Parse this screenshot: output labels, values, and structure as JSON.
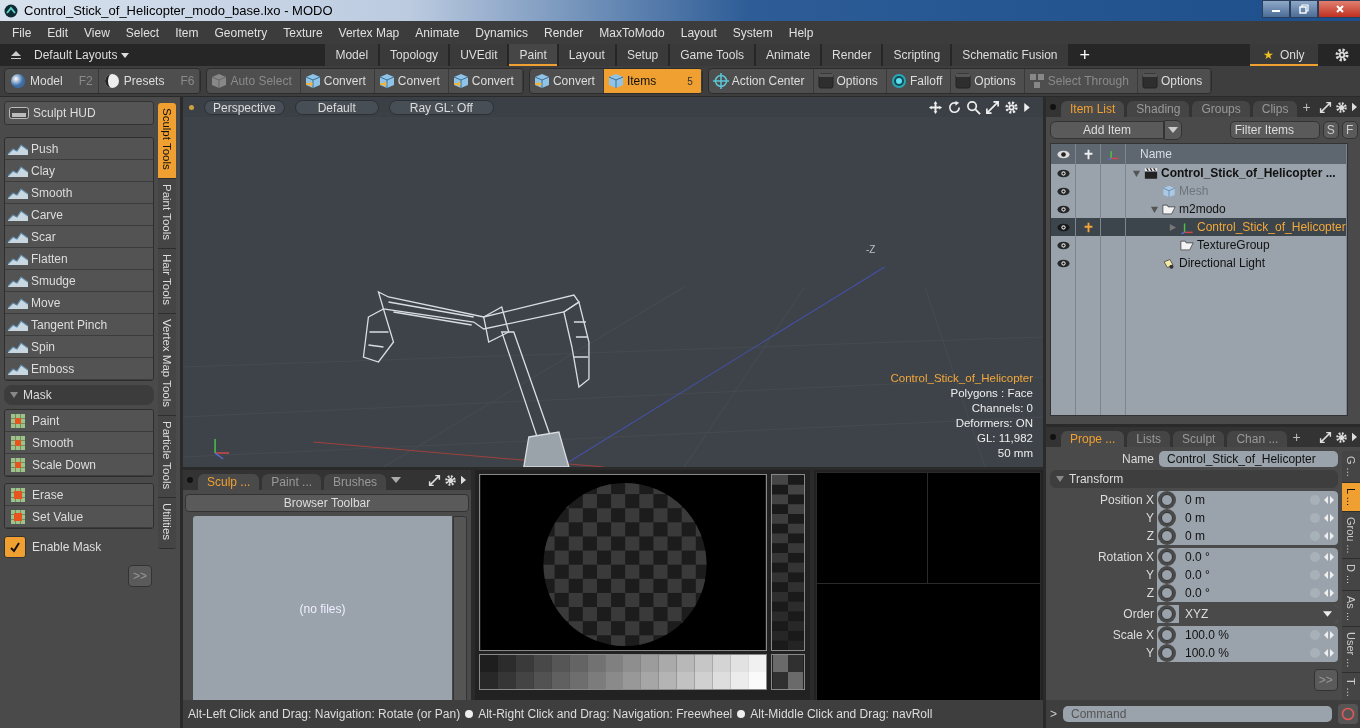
{
  "window": {
    "title": "Control_Stick_of_Helicopter_modo_base.lxo - MODO"
  },
  "menu": [
    "File",
    "Edit",
    "View",
    "Select",
    "Item",
    "Geometry",
    "Texture",
    "Vertex Map",
    "Animate",
    "Dynamics",
    "Render",
    "MaxToModo",
    "Layout",
    "System",
    "Help"
  ],
  "layout_bar": {
    "layouts_label": "Default Layouts",
    "tabs": [
      {
        "label": "Model",
        "selected": false
      },
      {
        "label": "Topology",
        "selected": false
      },
      {
        "label": "UVEdit",
        "selected": false
      },
      {
        "label": "Paint",
        "selected": true
      },
      {
        "label": "Layout",
        "selected": false
      },
      {
        "label": "Setup",
        "selected": false
      },
      {
        "label": "Game Tools",
        "selected": false
      },
      {
        "label": "Animate",
        "selected": false
      },
      {
        "label": "Render",
        "selected": false
      },
      {
        "label": "Scripting",
        "selected": false
      },
      {
        "label": "Schematic Fusion",
        "selected": false
      }
    ],
    "add_label": "+",
    "only": {
      "star": "★",
      "label": "Only",
      "on": true
    }
  },
  "toolbar": {
    "modes": [
      {
        "label": "Model",
        "key": "F2",
        "kind": "sphere"
      },
      {
        "label": "Presets",
        "key": "F6",
        "kind": "shade"
      }
    ],
    "groups": [
      [
        {
          "label": "Auto Select",
          "kind": "select",
          "disabled": true,
          "selected": false
        },
        {
          "label": "Convert",
          "kind": "convert",
          "disabled": false,
          "selected": false
        },
        {
          "label": "Convert",
          "kind": "convert",
          "disabled": false,
          "selected": false
        },
        {
          "label": "Convert",
          "kind": "convert",
          "disabled": false,
          "selected": false
        }
      ],
      [
        {
          "label": "Convert",
          "kind": "convert",
          "disabled": false,
          "selected": false
        },
        {
          "label": "Items",
          "kind": "select",
          "disabled": false,
          "selected": true,
          "count": "5"
        }
      ],
      [
        {
          "label": "Action Center",
          "kind": "center",
          "disabled": false,
          "selected": false
        },
        {
          "label": "Options",
          "kind": "options",
          "disabled": false,
          "selected": false
        },
        {
          "label": "Falloff",
          "kind": "falloff",
          "disabled": false,
          "selected": false
        },
        {
          "label": "Options",
          "kind": "options",
          "disabled": false,
          "selected": false
        },
        {
          "label": "Select Through",
          "kind": "through",
          "disabled": true,
          "selected": false
        },
        {
          "label": "Options",
          "kind": "options",
          "disabled": false,
          "selected": false
        }
      ]
    ]
  },
  "sculpt_panel": {
    "hud_label": "Sculpt HUD",
    "tools": [
      "Push",
      "Clay",
      "Smooth",
      "Carve",
      "Scar",
      "Flatten",
      "Smudge",
      "Move",
      "Tangent Pinch",
      "Spin",
      "Emboss"
    ],
    "mask_header": "Mask",
    "mask_tools": [
      "Paint",
      "Smooth",
      "Scale Down"
    ],
    "mask_tools_2": [
      "Erase",
      "Set Value"
    ],
    "enable_mask": {
      "label": "Enable Mask",
      "checked": true
    },
    "more_label": ">>",
    "side_tabs": [
      {
        "label": "Sculpt Tools",
        "selected": true
      },
      {
        "label": "Paint Tools",
        "selected": false
      },
      {
        "label": "Hair Tools",
        "selected": false
      },
      {
        "label": "Vertex Map Tools",
        "selected": false
      },
      {
        "label": "Particle Tools",
        "selected": false
      },
      {
        "label": "Utilities",
        "selected": false
      }
    ]
  },
  "viewport": {
    "buttons": [
      "Perspective",
      "Default",
      "Ray GL: Off"
    ],
    "axis_label": "-Z",
    "item_name": "Control_Stick_of_Helicopter",
    "info": [
      "Polygons : Face",
      "Channels: 0",
      "Deformers: ON",
      "GL: 11,982",
      "50 mm"
    ]
  },
  "browser": {
    "tabs": [
      {
        "label": "Sculp ...",
        "selected": true
      },
      {
        "label": "Paint ...",
        "selected": false
      },
      {
        "label": "Brushes",
        "selected": false
      }
    ],
    "toolbar_button": "Browser Toolbar",
    "empty_text": "(no files)"
  },
  "status_bar": [
    "Alt-Left Click and Drag: Navigation: Rotate (or Pan)",
    "Alt-Right Click and Drag: Navigation: Freewheel",
    "Alt-Middle Click and Drag: navRoll"
  ],
  "item_list": {
    "tabs": [
      {
        "label": "Item List",
        "selected": true
      },
      {
        "label": "Shading",
        "selected": false
      },
      {
        "label": "Groups",
        "selected": false
      },
      {
        "label": "Clips",
        "selected": false
      }
    ],
    "add_tab_label": "+",
    "add_item": "Add Item",
    "filter_placeholder": "Filter Items",
    "filter_buttons": [
      "S",
      "F"
    ],
    "name_header": "Name",
    "items": [
      {
        "name": "Control_Stick_of_Helicopter ...",
        "kind": "scene",
        "selected": false,
        "dimmed": false,
        "expanded": true,
        "children": [
          {
            "name": "Mesh",
            "kind": "mesh",
            "selected": false,
            "dimmed": true
          },
          {
            "name": "m2modo",
            "kind": "group",
            "selected": false,
            "dimmed": false,
            "expanded": true,
            "children": [
              {
                "name": "Control_Stick_of_Helicopter",
                "kind": "locator",
                "selected": true,
                "dimmed": false,
                "expanded": false
              },
              {
                "name": "TextureGroup",
                "kind": "group",
                "selected": false,
                "dimmed": false
              }
            ]
          },
          {
            "name": "Directional Light",
            "kind": "light",
            "selected": false,
            "dimmed": false
          }
        ]
      }
    ]
  },
  "properties": {
    "tabs": [
      {
        "label": "Prope ...",
        "selected": true
      },
      {
        "label": "Lists",
        "selected": false
      },
      {
        "label": "Sculpt",
        "selected": false
      },
      {
        "label": "Chan ...",
        "selected": false
      }
    ],
    "add_tab_label": "+",
    "name_label": "Name",
    "name_value": "Control_Stick_of_Helicopter",
    "section": "Transform",
    "groups": [
      {
        "kind": "numbers",
        "rows": [
          {
            "label": "Position X",
            "value": "0 m"
          },
          {
            "label": "Y",
            "value": "0 m"
          },
          {
            "label": "Z",
            "value": "0 m"
          }
        ]
      },
      {
        "kind": "numbers",
        "rows": [
          {
            "label": "Rotation X",
            "value": "0.0 °"
          },
          {
            "label": "Y",
            "value": "0.0 °"
          },
          {
            "label": "Z",
            "value": "0.0 °"
          }
        ]
      },
      {
        "kind": "dropdown",
        "rows": [
          {
            "label": "Order",
            "value": "XYZ"
          }
        ]
      },
      {
        "kind": "numbers",
        "rows": [
          {
            "label": "Scale X",
            "value": "100.0 %"
          },
          {
            "label": "Y",
            "value": "100.0 %"
          }
        ]
      }
    ],
    "more_label": ">>",
    "side_tabs": [
      {
        "label": "G ...",
        "selected": false
      },
      {
        "label": "L ...",
        "selected": true
      },
      {
        "label": "Grou ...",
        "selected": false
      },
      {
        "label": "D ...",
        "selected": false
      },
      {
        "label": "As ...",
        "selected": false
      },
      {
        "label": "User ...",
        "selected": false
      },
      {
        "label": "T ...",
        "selected": false
      }
    ]
  },
  "command": {
    "prompt": ">",
    "placeholder": "Command"
  }
}
